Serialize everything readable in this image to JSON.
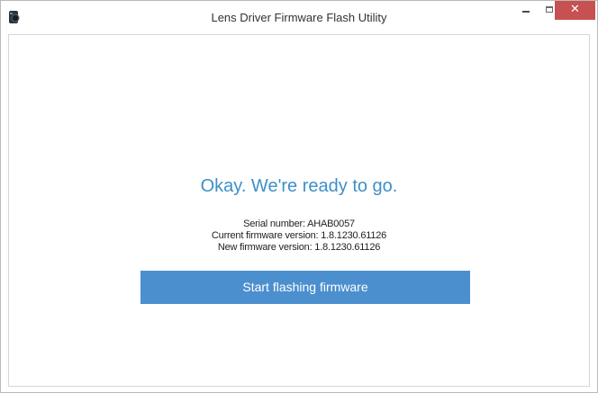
{
  "window": {
    "title": "Lens Driver Firmware Flash Utility",
    "app_icon": "device-icon",
    "controls": {
      "minimize_icon": "minimize-icon",
      "maximize_icon": "maximize-icon",
      "close_icon": "close-icon",
      "close_glyph": "✕"
    }
  },
  "main": {
    "heading": "Okay. We're ready to go.",
    "serial_line": "Serial number: AHAB0057",
    "current_fw_line": "Current firmware version: 1.8.1230.61126",
    "new_fw_line": "New firmware version: 1.8.1230.61126",
    "action_button_label": "Start flashing firmware"
  },
  "colors": {
    "heading": "#3d8fc9",
    "button_bg": "#4c8fcf",
    "close_bg": "#c75050"
  }
}
